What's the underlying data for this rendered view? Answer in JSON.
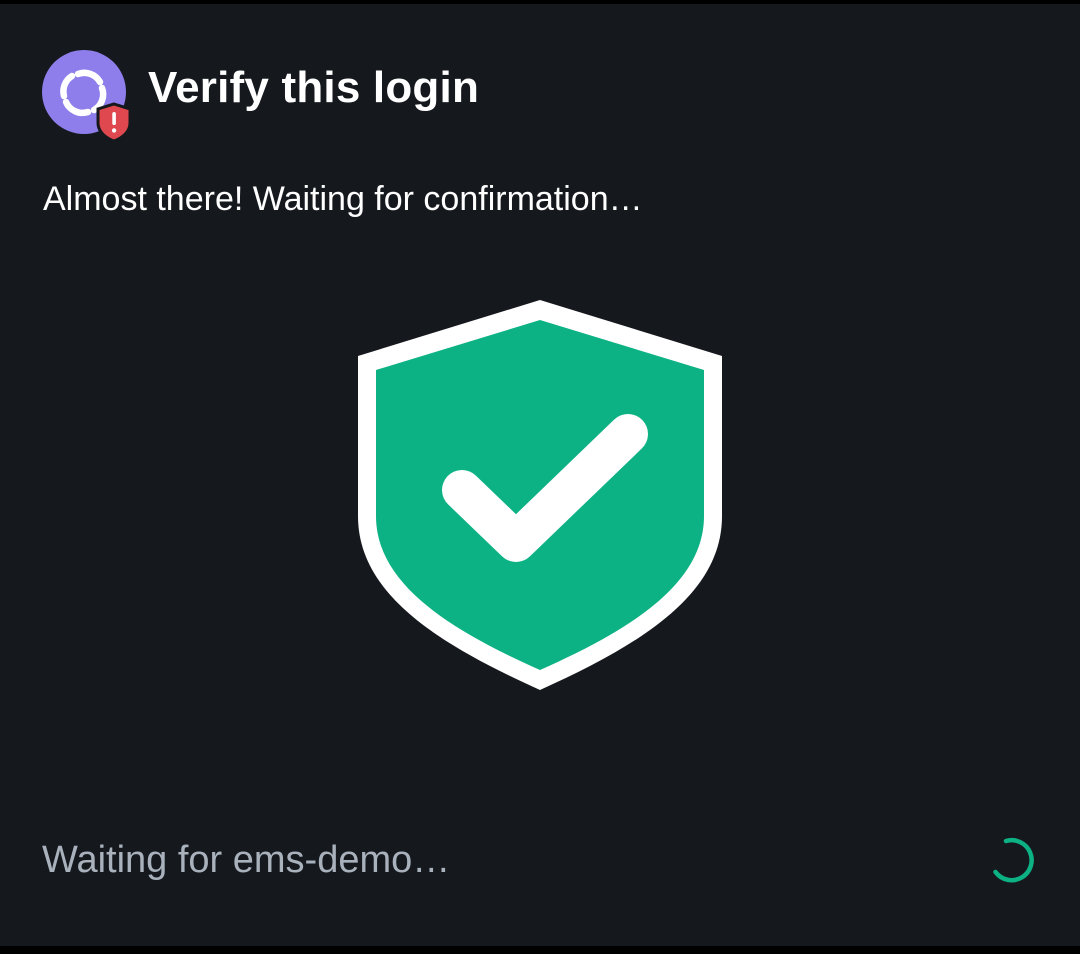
{
  "dialog": {
    "title": "Verify this login",
    "subtitle": "Almost there! Waiting for confirmation…",
    "status_text": "Waiting for ems-demo…"
  },
  "icons": {
    "app": "element-logo-icon",
    "badge": "shield-warning-icon",
    "hero": "shield-check-icon",
    "status": "loading-spinner-icon"
  },
  "colors": {
    "background": "#15191e",
    "title_text": "#ffffff",
    "status_text": "#a9b2bc",
    "brand_purple": "#8d7eec",
    "warning_red": "#e0484f",
    "success_green": "#0db284"
  }
}
